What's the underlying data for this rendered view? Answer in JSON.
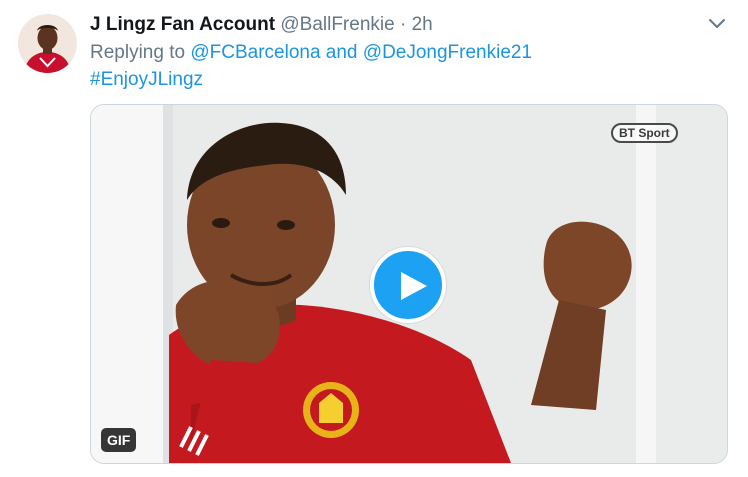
{
  "author": {
    "display_name": "J Lingz Fan Account",
    "handle": "@BallFrenkie",
    "separator": "·",
    "time": "2h",
    "avatar_icon": "profile-avatar"
  },
  "reply": {
    "prefix": "Replying to ",
    "mention_1": "@FCBarcelona",
    "conjunction": " and ",
    "mention_2": "@DeJongFrenkie21"
  },
  "body": {
    "hashtag": "#EnjoyJLingz"
  },
  "media": {
    "badge": "GIF",
    "watermark": "BT Sport",
    "play_icon": "play-icon"
  },
  "menu": {
    "icon": "chevron-down-icon"
  },
  "colors": {
    "link": "#1b95e0",
    "play_button": "#1da1f2",
    "muted_text": "#657786"
  }
}
